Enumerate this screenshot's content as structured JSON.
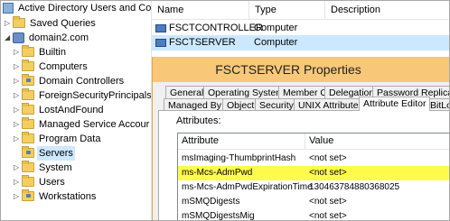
{
  "tree": {
    "items": [
      {
        "label": "Active Directory Users and Com",
        "icon": "aduc-console-icon",
        "expander": ""
      },
      {
        "label": "Saved Queries",
        "icon": "folder-icon",
        "expander": "▷"
      },
      {
        "label": "domain2.com",
        "icon": "domain-icon",
        "expander": "◢"
      },
      {
        "label": "Builtin",
        "icon": "folder-icon",
        "expander": "▷"
      },
      {
        "label": "Computers",
        "icon": "folder-icon",
        "expander": "▷"
      },
      {
        "label": "Domain Controllers",
        "icon": "ou-icon",
        "expander": "▷"
      },
      {
        "label": "ForeignSecurityPrincipals",
        "icon": "folder-icon",
        "expander": "▷"
      },
      {
        "label": "LostAndFound",
        "icon": "folder-icon",
        "expander": "▷"
      },
      {
        "label": "Managed Service Accour",
        "icon": "folder-icon",
        "expander": "▷"
      },
      {
        "label": "Program Data",
        "icon": "folder-icon",
        "expander": "▷"
      },
      {
        "label": "Servers",
        "icon": "ou-icon",
        "expander": ""
      },
      {
        "label": "System",
        "icon": "folder-icon",
        "expander": "▷"
      },
      {
        "label": "Users",
        "icon": "folder-icon",
        "expander": "▷"
      },
      {
        "label": "Workstations",
        "icon": "ou-icon",
        "expander": "▷"
      }
    ]
  },
  "list": {
    "columns": [
      "Name",
      "Type",
      "Description"
    ],
    "rows": [
      {
        "name": "FSCTCONTROLLER",
        "type": "Computer"
      },
      {
        "name": "FSCTSERVER",
        "type": "Computer"
      }
    ]
  },
  "dialog": {
    "title": "FSCTSERVER Properties",
    "tabs_row1": [
      "General",
      "Operating System",
      "Member Of",
      "Delegation",
      "Password Replicatio"
    ],
    "tabs_row2": [
      "Managed By",
      "Object",
      "Security",
      "UNIX Attributes",
      "Attribute Editor",
      "BitLoc"
    ],
    "attributes_label": "Attributes:",
    "grid_columns": [
      "Attribute",
      "Value"
    ],
    "grid_rows": [
      {
        "attribute": "msImaging-ThumbprintHash",
        "value": "<not set>"
      },
      {
        "attribute": "ms-Mcs-AdmPwd",
        "value": "<not set>"
      },
      {
        "attribute": "ms-Mcs-AdmPwdExpirationTime",
        "value": "130463784880368025"
      },
      {
        "attribute": "mSMQDigests",
        "value": "<not set>"
      },
      {
        "attribute": "mSMQDigestsMig",
        "value": "<not set>"
      }
    ]
  },
  "colors": {
    "titlebar": "#f8c878",
    "highlight": "#fffb4a",
    "selection": "#cde8ff"
  }
}
